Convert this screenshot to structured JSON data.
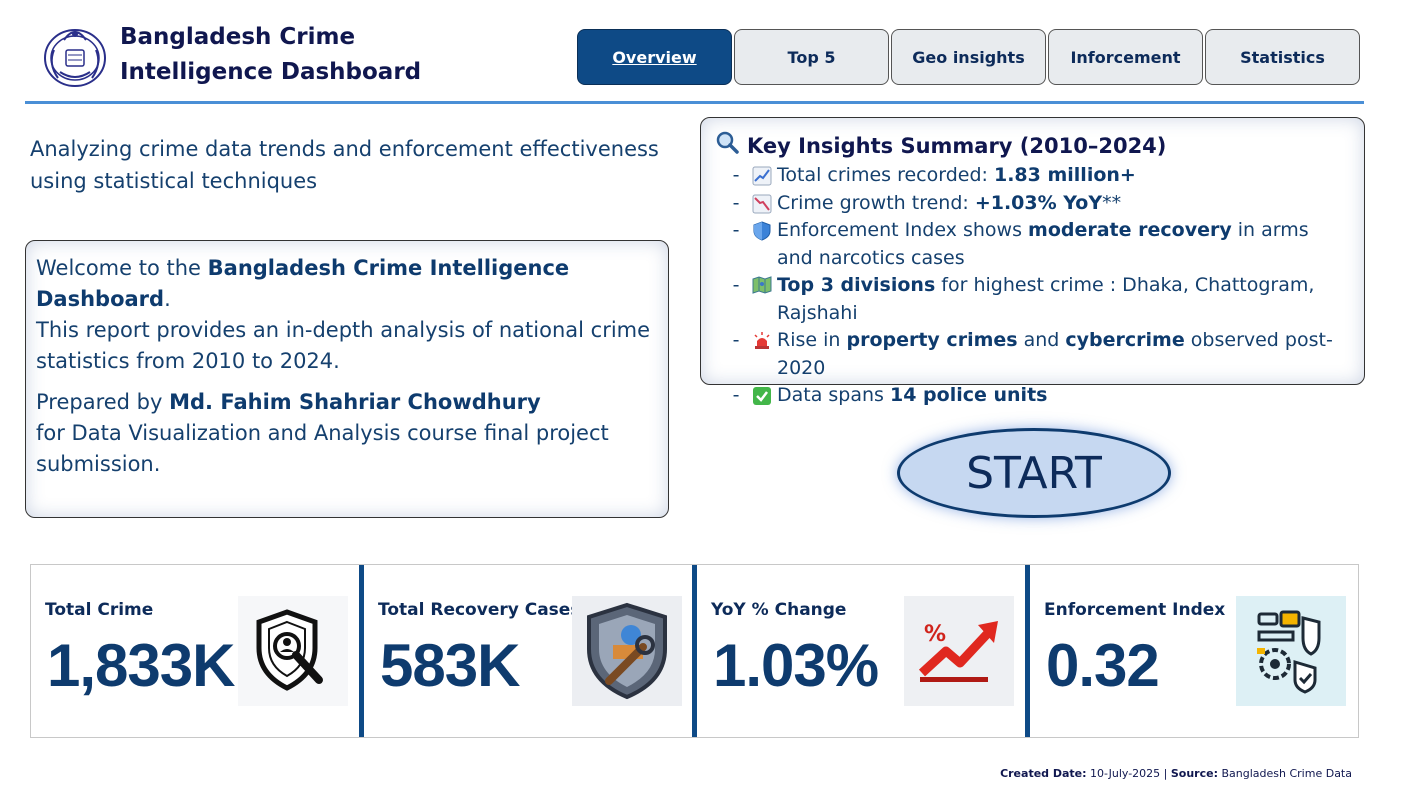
{
  "header": {
    "title_line1": "Bangladesh Crime",
    "title_line2": "Intelligence Dashboard",
    "tabs": [
      {
        "label": "Overview",
        "active": true
      },
      {
        "label": "Top 5",
        "active": false
      },
      {
        "label": "Geo insights",
        "active": false
      },
      {
        "label": "Inforcement",
        "active": false
      },
      {
        "label": "Statistics",
        "active": false
      }
    ]
  },
  "subtitle": "Analyzing crime data trends and enforcement effectiveness using statistical techniques",
  "welcome": {
    "p1_intro": "Welcome to the ",
    "p1_bold": "Bangladesh Crime Intelligence Dashboard",
    "p1_end": ".",
    "p1_body": "This report provides an in-depth analysis of national crime statistics from 2010 to 2024.",
    "p2_intro": "Prepared by ",
    "p2_bold": "Md. Fahim Shahriar Chowdhury",
    "p2_body": "for Data Visualization and Analysis course final project submission."
  },
  "insights": {
    "title": "Key Insights Summary (2010–2024)",
    "title_icon": "magnifier-icon",
    "items": [
      {
        "icon": "chart-increasing-icon",
        "pre": "Total crimes recorded: ",
        "bold": "1.83 million+",
        "post": ""
      },
      {
        "icon": "chart-decreasing-icon",
        "pre": "Crime growth trend: ",
        "bold": "+1.03% YoY",
        "post": "**"
      },
      {
        "icon": "shield-icon",
        "pre": "Enforcement Index shows ",
        "bold": "moderate recovery",
        "post": " in arms and narcotics cases"
      },
      {
        "icon": "map-icon",
        "pre": "",
        "bold": "Top 3 divisions",
        "post": " for highest crime : Dhaka, Chattogram, Rajshahi"
      },
      {
        "icon": "siren-icon",
        "pre": "Rise in ",
        "bold": "property crimes",
        "mid": " and ",
        "bold2": "cybercrime",
        "post": " observed post-2020"
      },
      {
        "icon": "check-icon",
        "pre": "Data spans ",
        "bold": "14 police units",
        "post": ""
      }
    ]
  },
  "start_button": {
    "label": "START"
  },
  "kpis": [
    {
      "label": "Total Crime",
      "value": "1,833K",
      "icon": "crime-shield-magnifier-icon"
    },
    {
      "label": "Total Recovery Cases",
      "value": "583K",
      "icon": "recovery-shield-icon"
    },
    {
      "label": "YoY % Change",
      "value": "1.03%",
      "icon": "trend-up-percent-icon"
    },
    {
      "label": "Enforcement Index",
      "value": "0.32",
      "icon": "enforcement-gears-icon"
    }
  ],
  "footer": {
    "created_label": "Created Date:",
    "created_value": " 10-July-2025 | ",
    "source_label": "Source:",
    "source_value": " Bangladesh Crime Data"
  },
  "colors": {
    "accent": "#0e4a86",
    "text_dark": "#10174f",
    "text_body": "#15406e",
    "rule": "#4a8fd6",
    "start_fill": "#c6d8f1"
  }
}
